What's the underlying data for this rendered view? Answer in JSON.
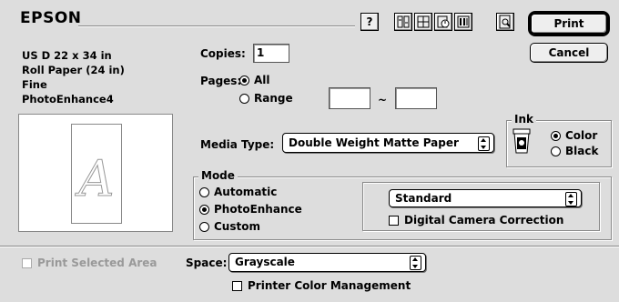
{
  "header": {
    "brand": "EPSON",
    "help_label": "?",
    "toolbar_icons": [
      "printer-utility-icon",
      "layout-icon",
      "background-printing-icon",
      "advanced-settings-icon",
      "preview-icon"
    ]
  },
  "actions": {
    "print_label": "Print",
    "cancel_label": "Cancel"
  },
  "summary": {
    "lines": [
      "US D 22 x 34 in",
      "Roll Paper (24 in)",
      "Fine",
      "PhotoEnhance4"
    ]
  },
  "preview": {
    "glyph": "A"
  },
  "copies": {
    "label": "Copies:",
    "value": "1"
  },
  "pages": {
    "label": "Pages:",
    "all_label": "All",
    "range_label": "Range",
    "range_separator": "~",
    "from_value": "",
    "to_value": "",
    "selected": "All"
  },
  "media": {
    "label": "Media Type:",
    "value": "Double Weight Matte Paper"
  },
  "ink": {
    "legend": "Ink",
    "color_label": "Color",
    "black_label": "Black",
    "selected": "Color"
  },
  "mode": {
    "legend": "Mode",
    "automatic_label": "Automatic",
    "photoenhance_label": "PhotoEnhance",
    "custom_label": "Custom",
    "selected": "PhotoEnhance",
    "preset_value": "Standard",
    "digital_camera_label": "Digital Camera Correction",
    "digital_camera_checked": false
  },
  "bottom": {
    "print_selected_label": "Print Selected Area",
    "print_selected_enabled": false,
    "space_label": "Space:",
    "space_value": "Grayscale",
    "color_mgmt_label": "Printer Color Management",
    "color_mgmt_checked": false
  },
  "colors": {
    "background": "#dddddd",
    "accent": "#000000"
  }
}
